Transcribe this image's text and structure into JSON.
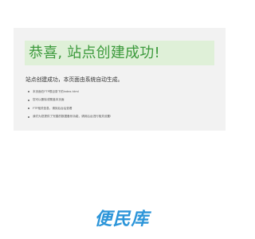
{
  "panel": {
    "title": "恭喜, 站点创建成功!",
    "description": "站点创建成功，本页面由系统自动生成。",
    "steps": [
      "本页面在FTP根目录下的index.html",
      "您可以删除或覆盖本页面",
      "FTP相关信息，请到后台后查看",
      "我们为您提供了完善的数据备份功能，请到后台进行相关设置!"
    ]
  },
  "footer": {
    "logo_text": "便民库"
  },
  "colors": {
    "banner_bg": "#dff0d8",
    "title_green": "#3c9a3c",
    "panel_bg": "#f2f2f2",
    "logo_blue": "#2c95d9"
  }
}
